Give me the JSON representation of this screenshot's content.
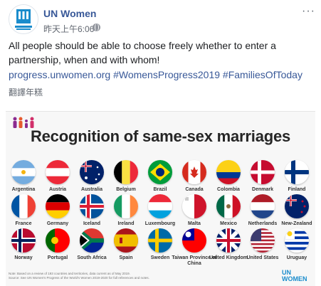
{
  "post": {
    "page_name": "UN Women",
    "timestamp": "昨天上午6:06",
    "body_text": "All people should be able to choose freely whether to enter a partnership, when and with whom!",
    "link_text": "progress.unwomen.org",
    "hashtag_1": "#WomensProgress2019",
    "hashtag_2": "#FamiliesOfToday",
    "translate_label": "翻譯年糕",
    "more_label": "···"
  },
  "infographic": {
    "title": "Recognition of same-sex marriages",
    "countries": [
      "Argentina",
      "Austria",
      "Australia",
      "Belgium",
      "Brazil",
      "Canada",
      "Colombia",
      "Denmark",
      "Finland",
      "France",
      "Germany",
      "Iceland",
      "Ireland",
      "Luxembourg",
      "Malta",
      "Mexico",
      "Netherlands",
      "New-Zealand",
      "Norway",
      "Portugal",
      "South Africa",
      "Spain",
      "Sweden",
      "Taiwan Province of China",
      "United Kingdom",
      "United States",
      "Uruguay"
    ],
    "note_line_1": "Note: Based on a review of 193 countries and territories, data current as of May 2019.",
    "note_line_2": "Source: See UN Women's Progress of the World's Women 2019-2020 for full references and notes.",
    "logo_text": "UN WOMEN"
  },
  "colors": {
    "link_blue": "#385898",
    "logo_blue": "#1a8ccc"
  }
}
